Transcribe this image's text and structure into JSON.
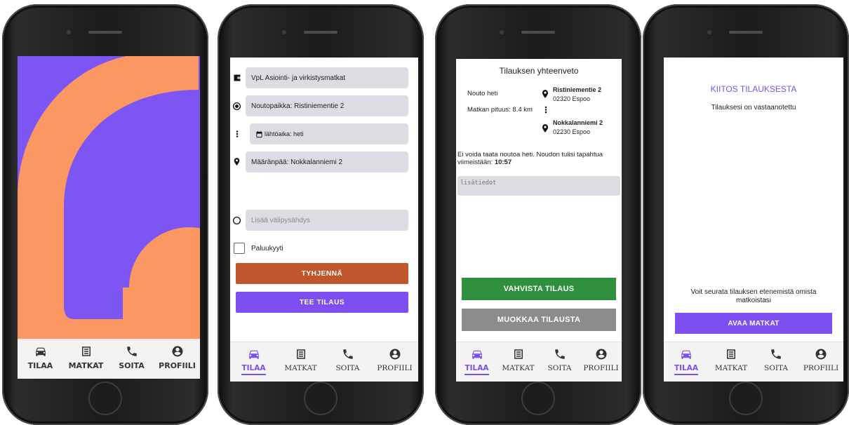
{
  "nav": {
    "items": [
      {
        "label": "TILAA",
        "icon": "car-icon"
      },
      {
        "label": "MATKAT",
        "icon": "list-icon"
      },
      {
        "label": "SOITA",
        "icon": "phone-icon"
      },
      {
        "label": "PROFIILI",
        "icon": "account-icon"
      }
    ]
  },
  "order_form": {
    "service": "VpL Asiointi- ja virkistysmatkat",
    "pickup": "Noutopaikka: Ristiniementie 2",
    "departure": "lähtöaika: heti",
    "destination": "Määränpää: Nokkalanniemi 2",
    "add_stop_placeholder": "Lisää välipysähdys",
    "return_trip_label": "Paluukyyti",
    "return_trip_checked": false,
    "clear_button": "TYHJENNÄ",
    "submit_button": "TEE TILAUS"
  },
  "summary": {
    "title": "Tilauksen yhteenveto",
    "pickup_time": "Nouto heti",
    "distance": "Matkan pituus: 8.4 km",
    "from_street": "Ristiniementie 2",
    "from_city": "02320 Espoo",
    "to_street": "Nokkalanniemi 2",
    "to_city": "02230 Espoo",
    "notice": "Ei voida taata noutoa heti. Noudon tulisi tapahtua viimeistään: ",
    "notice_time": "10:57",
    "notes_placeholder": "lisätiedot",
    "confirm_button": "VAHVISTA TILAUS",
    "edit_button": "MUOKKAA TILAUSTA"
  },
  "thanks": {
    "title": "KIITOS TILAUKSESTA",
    "subtitle": "Tilauksesi on vastaanotettu",
    "follow_text": "Voit seurata tilauksen etenemistä omista matkoistasi",
    "open_button": "AVAA MATKAT"
  },
  "colors": {
    "purple": "#7d55f2",
    "orange": "#fb9763",
    "clear_button": "#c0562b",
    "confirm_button": "#2f8f3c",
    "edit_button": "#8c8c8c"
  }
}
